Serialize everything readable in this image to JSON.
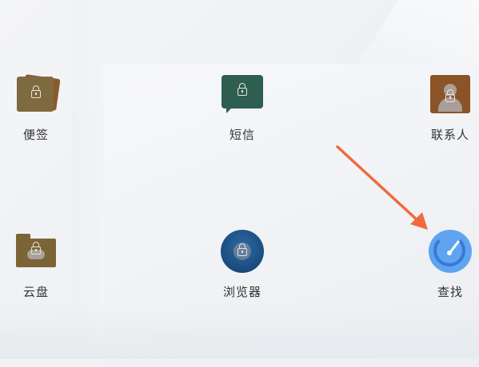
{
  "apps": [
    {
      "id": "memo",
      "label": "便签",
      "icon": "memo-icon",
      "locked": true
    },
    {
      "id": "sms",
      "label": "短信",
      "icon": "sms-icon",
      "locked": true
    },
    {
      "id": "contacts",
      "label": "联系人",
      "icon": "contacts-icon",
      "locked": true
    },
    {
      "id": "cloud",
      "label": "云盘",
      "icon": "cloud-folder-icon",
      "locked": true
    },
    {
      "id": "browser",
      "label": "浏览器",
      "icon": "browser-icon",
      "locked": true
    },
    {
      "id": "find",
      "label": "查找",
      "icon": "find-device-icon",
      "locked": false
    }
  ],
  "annotation": {
    "type": "arrow",
    "color": "#f06a3e",
    "target": "find"
  },
  "colors": {
    "label_text": "#333333",
    "background": "#f1f2f4"
  }
}
